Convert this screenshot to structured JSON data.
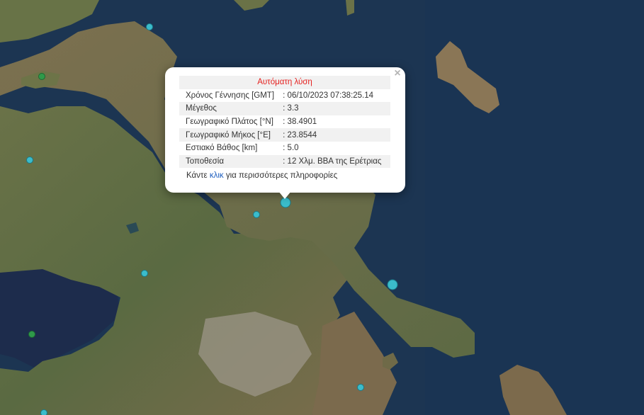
{
  "popup": {
    "title": "Αυτόματη λύση",
    "rows": [
      {
        "label": "Χρόνος Γέννησης [GMT]",
        "value": ": 06/10/2023 07:38:25.14"
      },
      {
        "label": "Μέγεθος",
        "value": ": 3.3"
      },
      {
        "label": "Γεωγραφικό Πλάτος [°N]",
        "value": ": 38.4901"
      },
      {
        "label": "Γεωγραφικό Μήκος [°E]",
        "value": ": 23.8544"
      },
      {
        "label": "Εστιακό Βάθος [km]",
        "value": ": 5.0"
      },
      {
        "label": "Τοποθεσία",
        "value": ": 12 Χλμ. ΒΒΑ της Ερέτριας"
      }
    ],
    "more_prefix": "Κάντε",
    "more_link": "κλικ",
    "more_suffix": "για περισσότερες πληροφορίες",
    "close_symbol": "×"
  },
  "colors": {
    "sea": "#1b3350",
    "land": "#5c6a45",
    "marker_cyan": "#3bbccb",
    "marker_green": "#2f9a4a",
    "title_red": "#e5211f",
    "link_blue": "#1f5fbf"
  }
}
